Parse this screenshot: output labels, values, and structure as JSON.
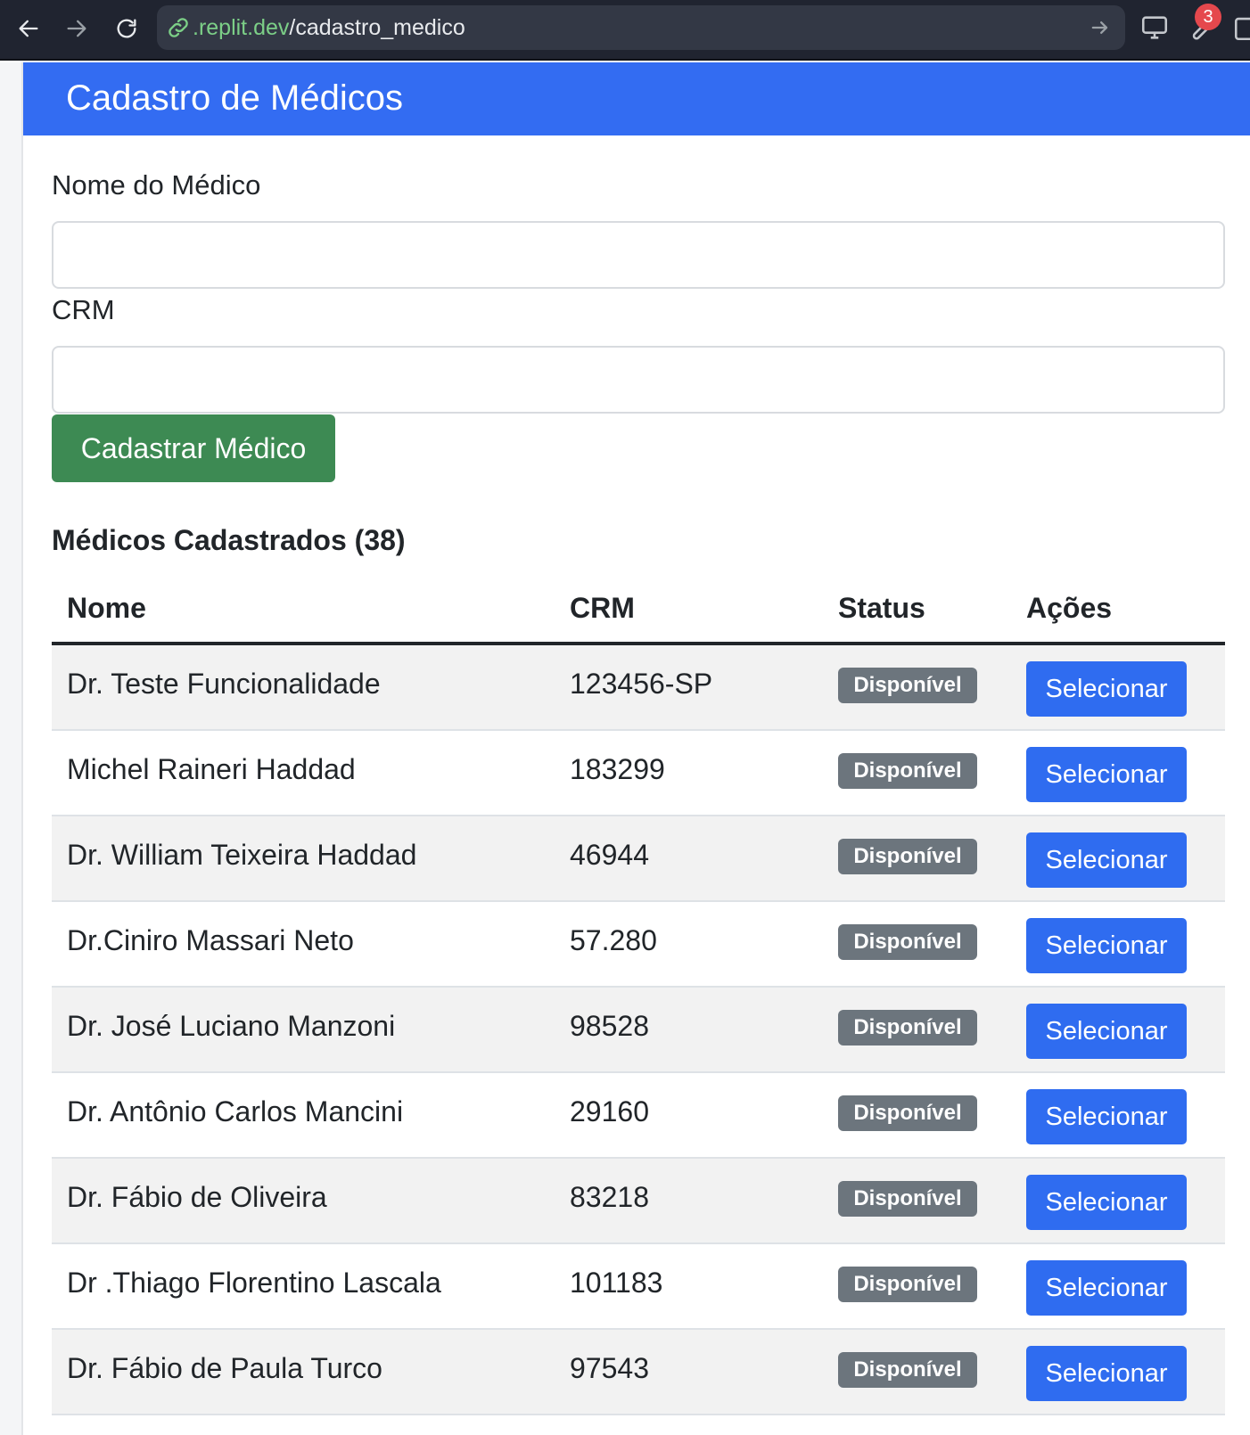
{
  "browser": {
    "url_host": ".replit.dev",
    "url_path": "/cadastro_medico",
    "extension_badge": "3",
    "icons": [
      "back-icon",
      "forward-icon",
      "reload-icon",
      "link-icon",
      "go-arrow-icon",
      "monitor-icon",
      "wrench-icon",
      "open-external-icon"
    ]
  },
  "header": {
    "title": "Cadastro de Médicos"
  },
  "form": {
    "name_label": "Nome do Médico",
    "name_value": "",
    "crm_label": "CRM",
    "crm_value": "",
    "submit_label": "Cadastrar Médico"
  },
  "list": {
    "title": "Médicos Cadastrados (38)",
    "columns": [
      "Nome",
      "CRM",
      "Status",
      "Ações"
    ],
    "rows": [
      {
        "name": "Dr. Teste Funcionalidade",
        "crm": "123456-SP",
        "status": "Disponível",
        "action": "Selecionar"
      },
      {
        "name": "Michel Raineri Haddad",
        "crm": "183299",
        "status": "Disponível",
        "action": "Selecionar"
      },
      {
        "name": "Dr. William Teixeira Haddad",
        "crm": "46944",
        "status": "Disponível",
        "action": "Selecionar"
      },
      {
        "name": "Dr.Ciniro Massari Neto",
        "crm": "57.280",
        "status": "Disponível",
        "action": "Selecionar"
      },
      {
        "name": "Dr. José Luciano Manzoni",
        "crm": "98528",
        "status": "Disponível",
        "action": "Selecionar"
      },
      {
        "name": "Dr. Antônio Carlos Mancini",
        "crm": "29160",
        "status": "Disponível",
        "action": "Selecionar"
      },
      {
        "name": "Dr. Fábio de Oliveira",
        "crm": "83218",
        "status": "Disponível",
        "action": "Selecionar"
      },
      {
        "name": "Dr .Thiago Florentino Lascala",
        "crm": "101183",
        "status": "Disponível",
        "action": "Selecionar"
      },
      {
        "name": "Dr. Fábio de Paula Turco",
        "crm": "97543",
        "status": "Disponível",
        "action": "Selecionar"
      }
    ]
  },
  "colors": {
    "header": "#336cf2",
    "success_button": "#3d8a53",
    "primary_button": "#2f6cf0",
    "badge": "#6c757d"
  }
}
